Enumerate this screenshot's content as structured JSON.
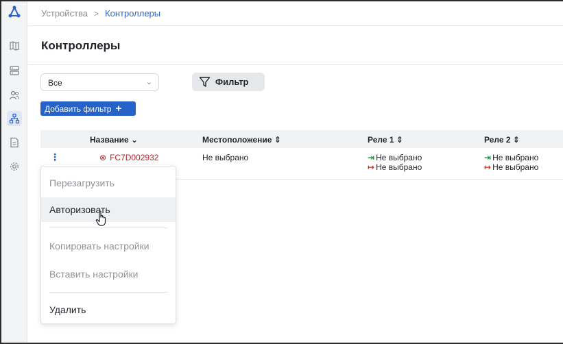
{
  "breadcrumb": {
    "parent": "Устройства",
    "separator": ">",
    "current": "Контроллеры"
  },
  "page_title": "Контроллеры",
  "filters": {
    "select_value": "Все",
    "filter_button": "Фильтр",
    "add_filter_button": "Добавить фильтр"
  },
  "table": {
    "headers": {
      "name": "Название",
      "location": "Местоположение",
      "relay1": "Реле 1",
      "relay2": "Реле 2"
    },
    "rows": [
      {
        "name": "FC7D002932",
        "location": "Не выбрано",
        "relay1_in": "Не выбрано",
        "relay1_out": "Не выбрано",
        "relay2_in": "Не выбрано",
        "relay2_out": "Не выбрано"
      }
    ]
  },
  "context_menu": {
    "items": [
      "Перезагрузить",
      "Авторизовать",
      "Копировать настройки",
      "Вставить настройки",
      "Удалить"
    ]
  },
  "colors": {
    "accent": "#2563c9",
    "error": "#b3262e",
    "relay_in": "#1f8a3b",
    "relay_out": "#c0392b"
  }
}
